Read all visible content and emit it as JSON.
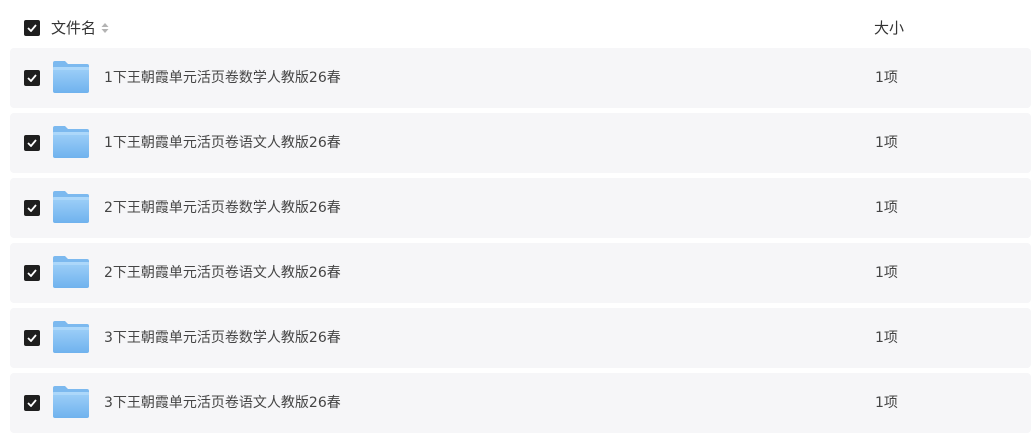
{
  "header": {
    "name_label": "文件名",
    "size_label": "大小"
  },
  "colors": {
    "checkbox": "#1f1f1f",
    "row_background": "#f6f6f8",
    "folder": "#8ec5f5"
  },
  "rows": [
    {
      "name": "1下王朝霞单元活页卷数学人教版26春",
      "size": "1项",
      "checked": true
    },
    {
      "name": "1下王朝霞单元活页卷语文人教版26春",
      "size": "1项",
      "checked": true
    },
    {
      "name": "2下王朝霞单元活页卷数学人教版26春",
      "size": "1项",
      "checked": true
    },
    {
      "name": "2下王朝霞单元活页卷语文人教版26春",
      "size": "1项",
      "checked": true
    },
    {
      "name": "3下王朝霞单元活页卷数学人教版26春",
      "size": "1项",
      "checked": true
    },
    {
      "name": "3下王朝霞单元活页卷语文人教版26春",
      "size": "1项",
      "checked": true
    }
  ]
}
